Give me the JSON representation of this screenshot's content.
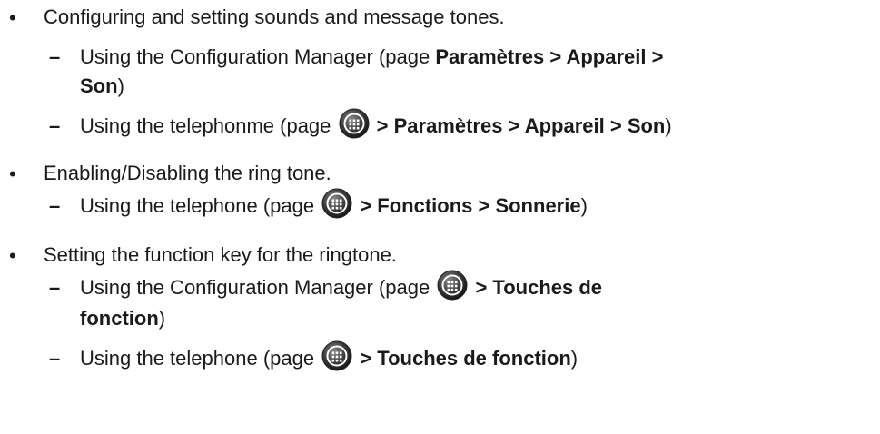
{
  "items": [
    {
      "text": "Configuring and setting sounds and message tones.",
      "subs": [
        {
          "prefix": "Using the Configuration Manager (page ",
          "bold": "Paramètres > Appareil >",
          "bold2": "Son",
          "suffix": ")"
        },
        {
          "prefix": "Using the telephonme (page ",
          "bold": " > Paramètres > Appareil > Son",
          "suffix": ")",
          "icon": "apps-grid-icon"
        }
      ]
    },
    {
      "text": "Enabling/Disabling the ring tone.",
      "subs": [
        {
          "prefix": "Using the telephone (page ",
          "bold": " > Fonctions > Sonnerie",
          "suffix": ")",
          "icon": "apps-grid-icon"
        }
      ]
    },
    {
      "text": "Setting the function key for the ringtone.",
      "subs": [
        {
          "prefix": "Using the Configuration Manager (page ",
          "bold": " > Touches de",
          "bold2": "fonction",
          "suffix": ")",
          "icon": "apps-grid-icon"
        },
        {
          "prefix": "Using the telephone (page ",
          "bold": " > Touches de fonction",
          "suffix": ")",
          "icon": "apps-grid-icon"
        }
      ]
    }
  ],
  "bullet_char": "•",
  "dash_char": "–"
}
